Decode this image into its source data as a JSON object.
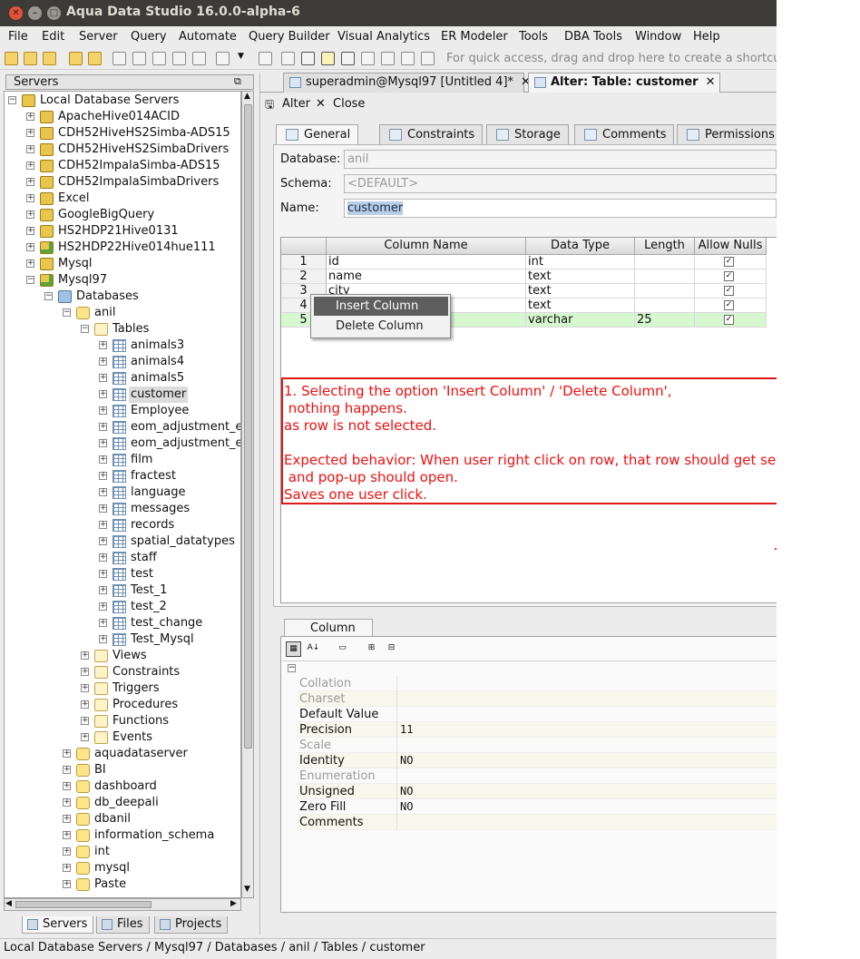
{
  "window": {
    "title": "Aqua Data Studio 16.0.0-alpha-6"
  },
  "menu": [
    "File",
    "Edit",
    "Server",
    "Query",
    "Automate",
    "Query Builder",
    "Visual Analytics",
    "ER Modeler",
    "Tools",
    "DBA Tools",
    "Window",
    "Help"
  ],
  "toolbar": {
    "quick_access": "For quick access, drag and drop here to create a shortcut"
  },
  "servers_panel": {
    "title": "Servers"
  },
  "tree": {
    "root": "Local Database Servers",
    "servers": [
      "ApacheHive014ACID",
      "CDH52HiveHS2Simba-ADS15",
      "CDH52HiveHS2SimbaDrivers",
      "CDH52ImpalaSimba-ADS15",
      "CDH52ImpalaSimbaDrivers",
      "Excel",
      "GoogleBigQuery",
      "HS2HDP21Hive0131",
      "HS2HDP22Hive014hue111",
      "Mysql",
      "Mysql97"
    ],
    "databases_label": "Databases",
    "db_anil": "anil",
    "tables_label": "Tables",
    "tables": [
      "animals3",
      "animals4",
      "animals5",
      "customer",
      "Employee",
      "eom_adjustment_ex",
      "eom_adjustment_ex",
      "film",
      "fractest",
      "language",
      "messages",
      "records",
      "spatial_datatypes",
      "staff",
      "test",
      "Test_1",
      "test_2",
      "test_change",
      "Test_Mysql"
    ],
    "folders": [
      "Views",
      "Constraints",
      "Triggers",
      "Procedures",
      "Functions",
      "Events"
    ],
    "other_dbs": [
      "aquadataserver",
      "BI",
      "dashboard",
      "db_deepali",
      "dbanil",
      "information_schema",
      "int",
      "mysql",
      "Paste"
    ]
  },
  "left_tabs": [
    "Servers",
    "Files",
    "Projects"
  ],
  "doc_tabs": [
    {
      "label": "superadmin@Mysql97 [Untitled 4]*",
      "close": "✕"
    },
    {
      "label": "Alter: Table: customer",
      "close": "✕"
    }
  ],
  "actions": {
    "alter": "Alter",
    "close": "Close"
  },
  "prop_tabs": [
    "General",
    "Constraints",
    "Storage",
    "Comments",
    "Permissions"
  ],
  "form": {
    "database_label": "Database:",
    "database_value": "anil",
    "schema_label": "Schema:",
    "schema_value": "<DEFAULT>",
    "name_label": "Name:",
    "name_value": "customer"
  },
  "grid": {
    "headers": [
      "Column Name",
      "Data Type",
      "Length",
      "Allow Nulls"
    ],
    "rows": [
      {
        "n": "1",
        "name": "id",
        "type": "int",
        "length": "",
        "nulls": "✓"
      },
      {
        "n": "2",
        "name": "name",
        "type": "text",
        "length": "",
        "nulls": "✓"
      },
      {
        "n": "3",
        "name": "city",
        "type": "text",
        "length": "",
        "nulls": "✓"
      },
      {
        "n": "4",
        "name": "",
        "type": "text",
        "length": "",
        "nulls": "✓"
      },
      {
        "n": "5",
        "name": "",
        "type": "varchar",
        "length": "25",
        "nulls": "✓"
      }
    ]
  },
  "context_menu": {
    "insert": "Insert Column",
    "delete": "Delete Column"
  },
  "annotation": {
    "lines": [
      "1. Selecting the option 'Insert Column' / 'Delete Column',",
      " nothing happens.",
      "as row is not selected.",
      "",
      "Expected behavior: When user right click on row, that row should get selected",
      " and pop-up should open.",
      "Saves one user click."
    ],
    "color": "#e01818"
  },
  "column_panel": {
    "tab": "Column",
    "props": [
      {
        "k": "Collation",
        "v": "",
        "dis": true
      },
      {
        "k": "Charset",
        "v": "",
        "dis": true
      },
      {
        "k": "Default Value",
        "v": "",
        "dis": false
      },
      {
        "k": "Precision",
        "v": "11",
        "dis": false
      },
      {
        "k": "Scale",
        "v": "",
        "dis": true
      },
      {
        "k": "Identity",
        "v": "NO",
        "dis": false
      },
      {
        "k": "Enumeration",
        "v": "",
        "dis": true
      },
      {
        "k": "Unsigned",
        "v": "NO",
        "dis": false
      },
      {
        "k": "Zero Fill",
        "v": "NO",
        "dis": false
      },
      {
        "k": "Comments",
        "v": "",
        "dis": false
      }
    ]
  },
  "status": {
    "path": "Local Database Servers / Mysql97 / Databases / anil / Tables / customer"
  }
}
